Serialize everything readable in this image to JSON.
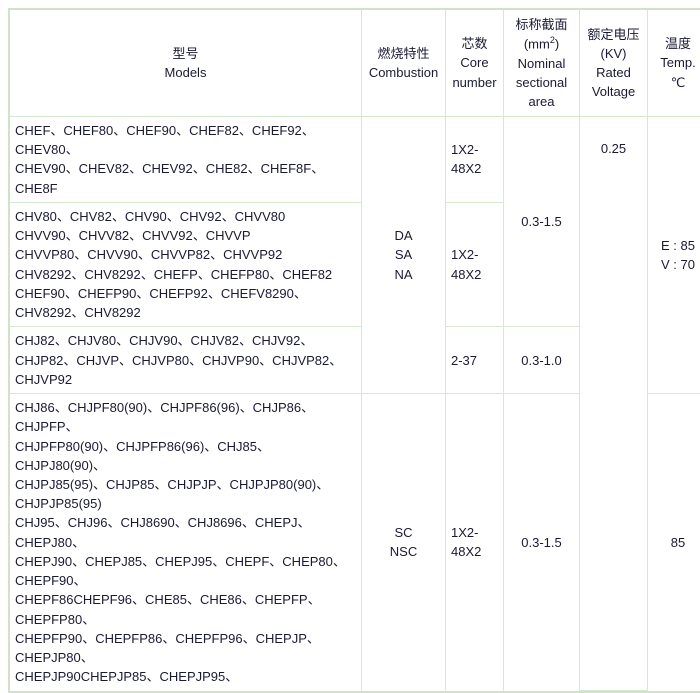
{
  "table": {
    "headers": [
      {
        "zh": "型号",
        "en": "Models",
        "name": "models"
      },
      {
        "zh": "燃烧特性",
        "en": "Combustion",
        "name": "combustion"
      },
      {
        "zh": "芯数",
        "en": "Core\nnumber",
        "name": "core-number"
      },
      {
        "zh": "标称截面",
        "unit": "(mm2)",
        "en": "Nominal\nsectional\narea",
        "name": "nominal-sectional-area"
      },
      {
        "zh": "额定电压",
        "unit": "(KV)",
        "en": "Rated\nVoltage",
        "name": "rated-voltage"
      },
      {
        "zh": "温度",
        "en": "Temp.\n℃",
        "name": "temperature"
      }
    ],
    "rows": [
      {
        "models": "CHEF、CHEF80、CHEF90、CHEF82、CHEF92、CHEV80、\nCHEV90、CHEV82、CHEV92、CHE82、CHEF8F、CHE8F",
        "core_number": "1X2-\n48X2"
      },
      {
        "models": "CHV80、CHV82、CHV90、CHV92、CHVV80\nCHVV90、CHVV82、CHVV92、CHVVP\nCHVVP80、CHVV90、CHVVP82、CHVVP92\nCHV8292、CHV8292、CHEFP、CHEFP80、CHEF82\nCHEF90、CHEFP90、CHEFP92、CHEFV8290、\nCHV8292、CHV8292",
        "core_number": "1X2-\n48X2"
      },
      {
        "models": "CHJ82、CHJV80、CHJV90、CHJV82、CHJV92、\nCHJP82、CHJVP、CHJVP80、CHJVP90、CHJVP82、\nCHJVP92",
        "core_number": "2-37",
        "sectional_area": "0.3-1.0"
      },
      {
        "models": "CHJ86、CHJPF80(90)、CHJPF86(96)、CHJP86、CHJPFP、\nCHJPFP80(90)、CHJPFP86(96)、CHJ85、CHJPJ80(90)、\nCHJPJ85(95)、CHJP85、CHJPJP、CHJPJP80(90)、CHJPJP85(95)\nCHJ95、CHJ96、CHJ8690、CHJ8696、CHEPJ、CHEPJ80、\nCHEPJ90、CHEPJ85、CHEPJ95、CHEPF、CHEP80、CHEPF90、\nCHEPF86CHEPF96、CHE85、CHE86、CHEPFP、CHEPFP80、\nCHEPFP90、CHEPFP86、CHEPFP96、CHEPJP、CHEPJP80、\nCHEPJP90CHEPJP85、CHEPJP95、",
        "core_number": "1X2-\n48X2",
        "sectional_area": "0.3-1.5"
      }
    ],
    "merged": {
      "combustion_top": "DA\nSA\nNA",
      "combustion_bottom": "SC\nNSC",
      "sectional_area_top": "0.3-1.5",
      "rated_voltage_all": "0.25",
      "temperature_top": "E : 85\nV : 70",
      "temperature_bottom": "85"
    }
  },
  "colors": {
    "border": "#d6e8cf",
    "outer_border": "#cfe3c8",
    "text": "#1a1a33",
    "background": "#ffffff"
  }
}
